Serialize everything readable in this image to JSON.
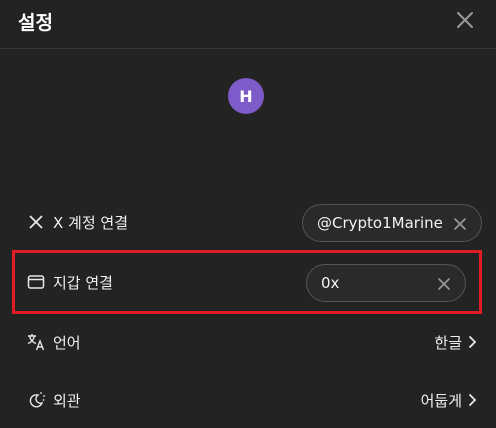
{
  "header": {
    "title": "설정",
    "close_icon": "close-icon"
  },
  "avatar": {
    "initial": "H",
    "color": "#7d5bc8"
  },
  "rows": {
    "x_account": {
      "icon": "x-logo-icon",
      "label": "X 계정 연결",
      "value": "@Crypto1Marine"
    },
    "wallet": {
      "icon": "wallet-icon",
      "label": "지갑 연결",
      "value": "0x"
    },
    "language": {
      "icon": "translate-icon",
      "label": "언어",
      "value": "한글"
    },
    "appearance": {
      "icon": "theme-icon",
      "label": "외관",
      "value": "어둡게"
    }
  },
  "colors": {
    "background": "#232323",
    "highlight": "#e01d24",
    "avatar": "#7d5bc8"
  }
}
